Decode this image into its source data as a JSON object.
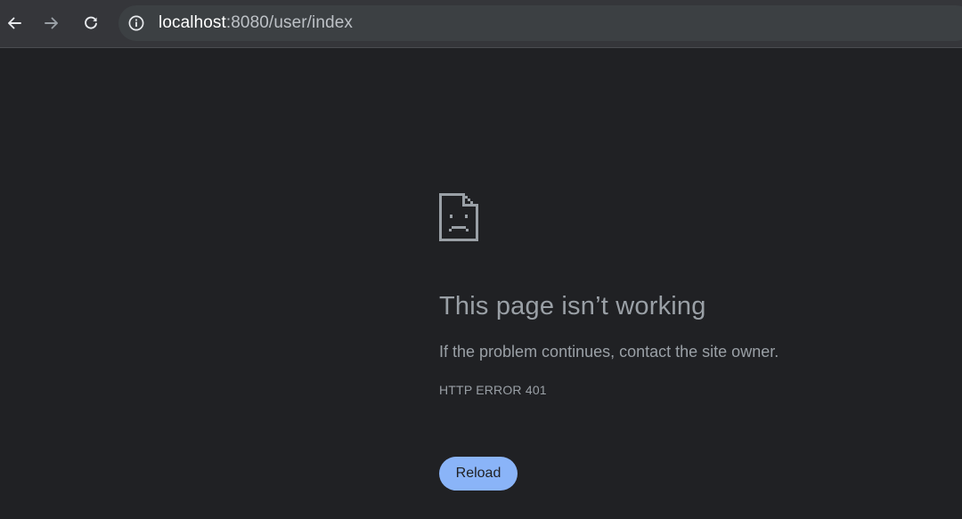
{
  "toolbar": {
    "back_icon": "arrow-left-icon",
    "forward_icon": "arrow-right-icon",
    "reload_icon": "refresh-icon",
    "site_info_icon": "info-circle-icon",
    "url_host": "localhost",
    "url_rest": ":8080/user/index"
  },
  "error_page": {
    "icon": "sad-page-icon",
    "title": "This page isn’t working",
    "message": "If the problem continues, contact the site owner.",
    "error_code": "HTTP ERROR 401",
    "reload_label": "Reload"
  },
  "colors": {
    "background": "#202124",
    "toolbar": "#35363a",
    "omnibox": "#3c4043",
    "text_muted": "#9aa0a6",
    "accent": "#8ab4f8"
  }
}
